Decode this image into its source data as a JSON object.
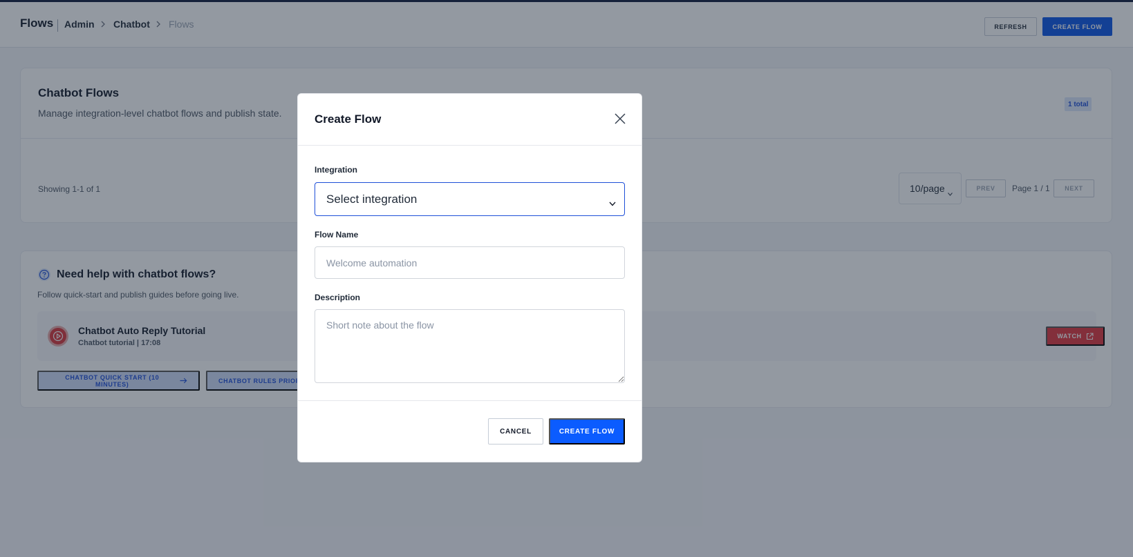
{
  "header": {
    "title": "Flows",
    "breadcrumb": [
      "Admin",
      "Chatbot",
      "Flows"
    ],
    "refresh_label": "REFRESH",
    "create_label": "CREATE FLOW"
  },
  "flows_card": {
    "title": "Chatbot Flows",
    "subtitle": "Manage integration-level chatbot flows and publish state.",
    "total_badge": "1 total",
    "showing": "Showing 1-1 of 1",
    "per_page": "10/page",
    "prev_label": "PREV",
    "page_info": "Page 1 / 1",
    "next_label": "NEXT"
  },
  "help_card": {
    "title": "Need help with chatbot flows?",
    "subtitle": "Follow quick-start and publish guides before going live.",
    "video_title": "Chatbot Auto Reply Tutorial",
    "video_meta": "Chatbot tutorial | 17:08",
    "watch_label": "WATCH",
    "guides": [
      "CHATBOT QUICK START (10 MINUTES)",
      "CHATBOT RULES PRIORI"
    ]
  },
  "modal": {
    "title": "Create Flow",
    "integration_label": "Integration",
    "integration_value": "Select integration",
    "flow_name_label": "Flow Name",
    "flow_name_placeholder": "Welcome automation",
    "description_label": "Description",
    "description_placeholder": "Short note about the flow",
    "cancel_label": "CANCEL",
    "create_label": "CREATE FLOW"
  },
  "colors": {
    "primary": "#0b5cff",
    "danger": "#e0353c",
    "overlay": "rgba(30,41,59,0.48)"
  }
}
